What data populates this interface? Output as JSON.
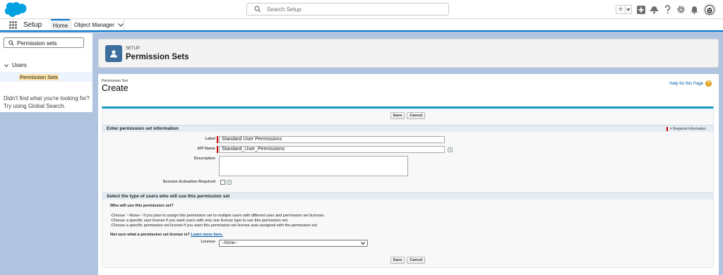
{
  "header": {
    "search_placeholder": "Search Setup",
    "icons": [
      "star-icon",
      "chevron-down-icon",
      "plus-icon",
      "trailhead-icon",
      "help-icon",
      "gear-icon",
      "bell-icon",
      "avatar-icon"
    ]
  },
  "nav": {
    "app_name": "Setup",
    "tabs": [
      {
        "label": "Home"
      },
      {
        "label": "Object Manager"
      }
    ]
  },
  "sidebar": {
    "quick_find_value": "Permission sets",
    "tree": [
      {
        "label": "Users",
        "children": [
          {
            "label": "Permission Sets",
            "selected": true
          }
        ]
      }
    ],
    "help_text": "Didn't find what you're looking for? Try using Global Search."
  },
  "page_header": {
    "eyebrow": "SETUP",
    "title": "Permission Sets"
  },
  "content": {
    "breadcrumb": "Permission Set",
    "title": "Create",
    "help_link": "Help for this Page",
    "buttons": {
      "save": "Save",
      "cancel": "Cancel"
    },
    "section1": {
      "title": "Enter permission set information",
      "required_legend": "= Required Information",
      "fields": {
        "label": {
          "label": "Label",
          "value": "Standard User Permissions"
        },
        "api_name": {
          "label": "API Name",
          "value": "Standard_User_Permissions"
        },
        "description": {
          "label": "Description",
          "value": ""
        },
        "session": {
          "label": "Session Activation Required",
          "checked": false
        }
      },
      "info_glyph": "i"
    },
    "section2": {
      "title": "Select the type of users who will use this permission set",
      "question": "Who will use this permission set?",
      "bullets": [
        "-Choose '--None--' if you plan to assign this permission set to multiple users with different user and permission set licenses.",
        "-Choose a specific user license if you want users with only one license type to use this permission set.",
        "-Choose a specific permission set license if you want this permission set license auto-assigned with the permission set."
      ],
      "not_sure": "Not sure what a permission set license is?",
      "learn_more": "Learn more here.",
      "license_label": "License",
      "license_value": "--None--"
    }
  },
  "colors": {
    "brand": "#0176d3",
    "section_bar": "#1797c0",
    "required": "#cc0000",
    "background": "#b0c4df"
  }
}
